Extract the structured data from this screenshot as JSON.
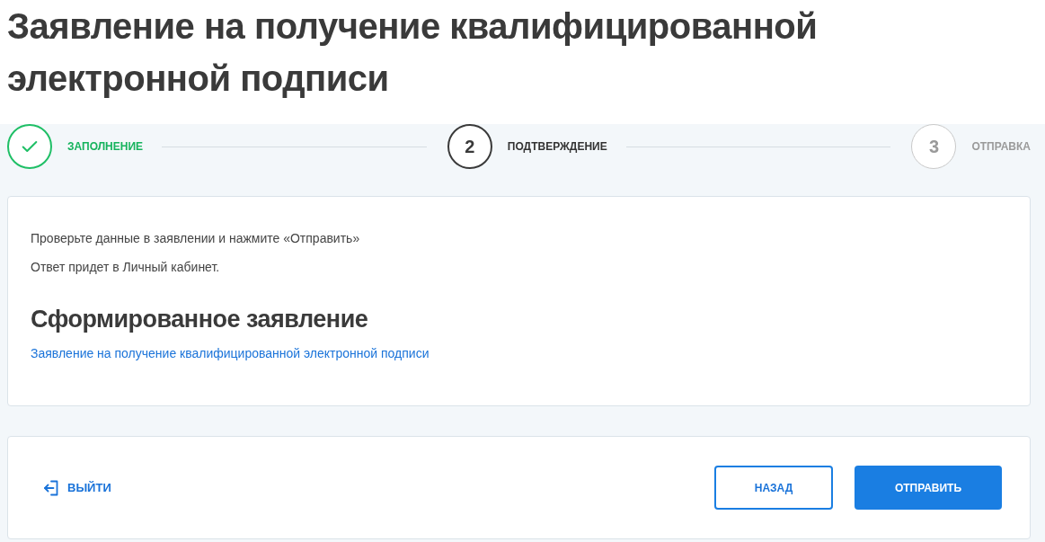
{
  "page_title": "Заявление на получение квалифицированной электронной подписи",
  "steps": [
    {
      "label": "ЗАПОЛНЕНИЕ",
      "kind": "done"
    },
    {
      "number": "2",
      "label": "ПОДТВЕРЖДЕНИЕ",
      "kind": "current"
    },
    {
      "number": "3",
      "label": "ОТПРАВКА",
      "kind": "pending"
    }
  ],
  "review_card": {
    "instructions": [
      "Проверьте данные в заявлении и нажмите «Отправить»",
      "Ответ придет в Личный кабинет."
    ],
    "section_title": "Сформированное заявление",
    "document_link": "Заявление на получение квалифицированной электронной подписи"
  },
  "footer": {
    "exit_link": "ВЫЙТИ",
    "buttons": [
      {
        "label": "НАЗАД",
        "kind": "outline"
      },
      {
        "label": "ОТПРАВИТЬ",
        "kind": "primary"
      }
    ]
  }
}
